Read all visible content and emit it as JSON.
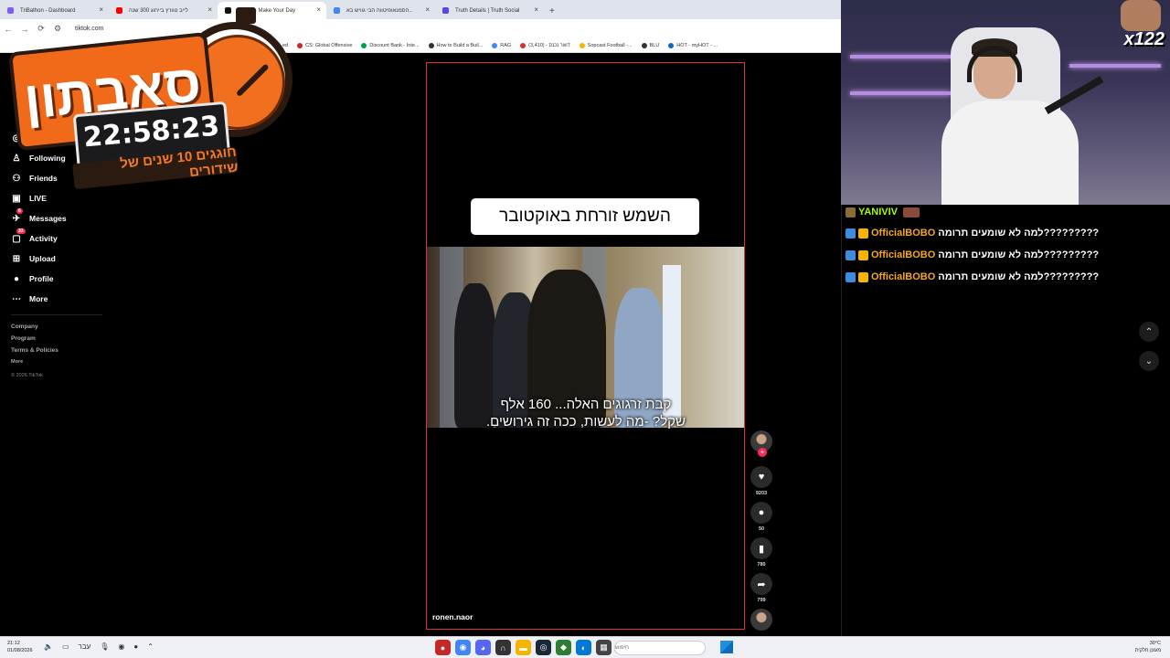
{
  "browser": {
    "tabs": [
      {
        "label": "TriBathon - Dashboard",
        "color": "#7c5cff",
        "active": false
      },
      {
        "label": "לייב טוורץ בייחוג 300 שנה",
        "color": "#ff0000",
        "active": false
      },
      {
        "label": "TikTok - Make Your Day",
        "color": "#111111",
        "active": true
      },
      {
        "label": "הסמנאופיטווה הבי גוויש בא..",
        "color": "#4285f4",
        "active": false
      },
      {
        "label": "Truth Details | Truth Social",
        "color": "#5448ee",
        "active": false
      }
    ],
    "new_tab": "+",
    "url": "tiktok.com",
    "bookmarks": [
      {
        "label": "ed",
        "color": "#9146ff"
      },
      {
        "label": "CS: Global Offensive",
        "color": "#c62828"
      },
      {
        "label": "Discount Bank - Inte...",
        "color": "#00a14b"
      },
      {
        "label": "How to Build a Buil...",
        "color": "#333333"
      },
      {
        "label": "RAG",
        "color": "#4285f4"
      },
      {
        "label": "(3,410) - דואר נכנס",
        "color": "#d93025"
      },
      {
        "label": "Sopcast Football -...",
        "color": "#f5b400"
      },
      {
        "label": "BLU",
        "color": "#333333"
      },
      {
        "label": "HOT - myHOT - ...",
        "color": "#1565c0"
      }
    ]
  },
  "tiktok": {
    "sidebar": [
      {
        "label": "Explore",
        "icon": "compass-icon",
        "glyph": "◎"
      },
      {
        "label": "Following",
        "icon": "person-icon",
        "glyph": "♙"
      },
      {
        "label": "Friends",
        "icon": "friends-icon",
        "glyph": "⚇"
      },
      {
        "label": "LIVE",
        "icon": "live-icon",
        "glyph": "▣"
      },
      {
        "label": "Messages",
        "icon": "messages-icon",
        "glyph": "✈",
        "badge": "6"
      },
      {
        "label": "Activity",
        "icon": "activity-icon",
        "glyph": "▢",
        "badge": "33"
      },
      {
        "label": "Upload",
        "icon": "upload-icon",
        "glyph": "⊞"
      },
      {
        "label": "Profile",
        "icon": "profile-icon",
        "glyph": "●"
      },
      {
        "label": "More",
        "icon": "more-icon",
        "glyph": "⋯"
      }
    ],
    "footer": [
      "Company",
      "Program",
      "Terms & Policies",
      "More"
    ],
    "copyright": "© 2026 TikTok",
    "video": {
      "caption": "השמש זורחת באוקטובר",
      "subtitle_line1": "קבת זרגוגים האלה... 160 אלף",
      "subtitle_line2": "שקל? -מה לעשות, ככה זה גירושים.",
      "author": "ronen.naor"
    },
    "actions": {
      "likes": "9203",
      "comments": "50",
      "saves": "780",
      "shares": "799"
    }
  },
  "overlay": {
    "title": "סאבתון",
    "timer": "22:58:23",
    "tagline": "חוגגים 10 שנים של שידורים"
  },
  "stream": {
    "multiplier": "x122",
    "chat": [
      {
        "user": "YANIVIV",
        "message": "",
        "name_color": "#a6ff00"
      },
      {
        "user": "OfficialBOBO",
        "message": "למה לא שומעים תרומה?????????",
        "name_color": "#f5a623"
      },
      {
        "user": "OfficialBOBO",
        "message": "למה לא שומעים תרומה?????????",
        "name_color": "#f5a623"
      },
      {
        "user": "OfficialBOBO",
        "message": "למה לא שומעים תרומה?????????",
        "name_color": "#f5a623"
      }
    ]
  },
  "taskbar": {
    "time": "21:12",
    "date": "01/08/2026",
    "lang": "עבר",
    "search_placeholder": "חיפוש",
    "temperature": "30°C",
    "weather": "מעונן חלקית"
  }
}
